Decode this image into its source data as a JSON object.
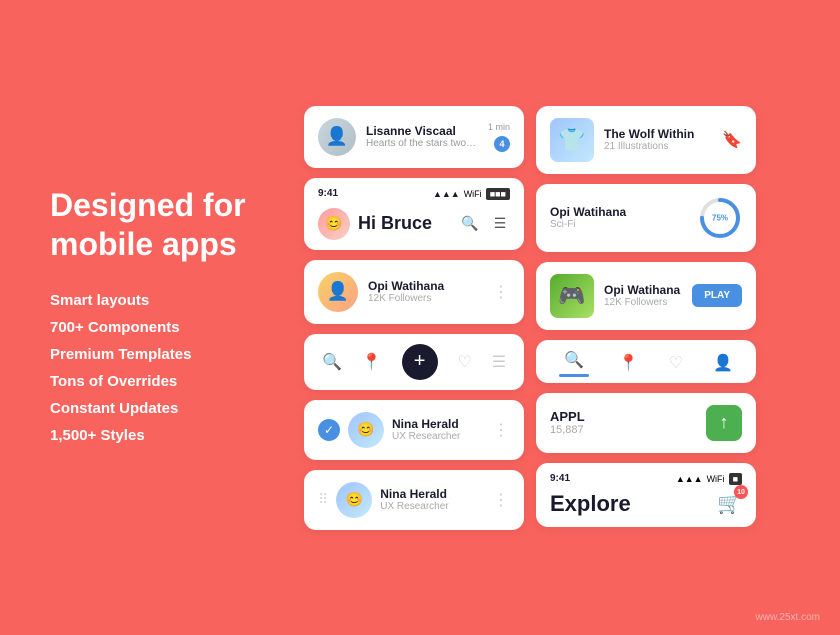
{
  "leftSection": {
    "title": "Designed for\nmobile apps",
    "features": [
      "Smart layouts",
      "700+ Components",
      "Premium Templates",
      "Tons of Overrides",
      "Constant Updates",
      "1,500+ Styles"
    ]
  },
  "leftCards": {
    "message": {
      "name": "Lisanne Viscaal",
      "time": "1 min",
      "preview": "Hearts of the stars two ghostly white figures in coveralls and helmets ar...",
      "badge": "4"
    },
    "greeting": {
      "time": "9:41",
      "name": "Hi Bruce"
    },
    "profile1": {
      "name": "Opi Watihana",
      "followers": "12K Followers"
    },
    "user1": {
      "name": "Nina Herald",
      "role": "UX Researcher"
    },
    "user2": {
      "name": "Nina Herald",
      "role": "UX Researcher"
    }
  },
  "rightCards": {
    "book": {
      "title": "The Wolf Within",
      "subtitle": "21 Illustrations"
    },
    "progress": {
      "title": "Opi Watihana",
      "genre": "Sci-Fi",
      "percent": 75
    },
    "game": {
      "title": "Opi Watihana",
      "followers": "12K Followers",
      "btnLabel": "PLAY"
    },
    "stock": {
      "name": "APPL",
      "price": "15,887"
    },
    "explore": {
      "time": "9:41",
      "title": "Explore",
      "cartCount": "10"
    }
  },
  "watermark": "www.25xt.com"
}
